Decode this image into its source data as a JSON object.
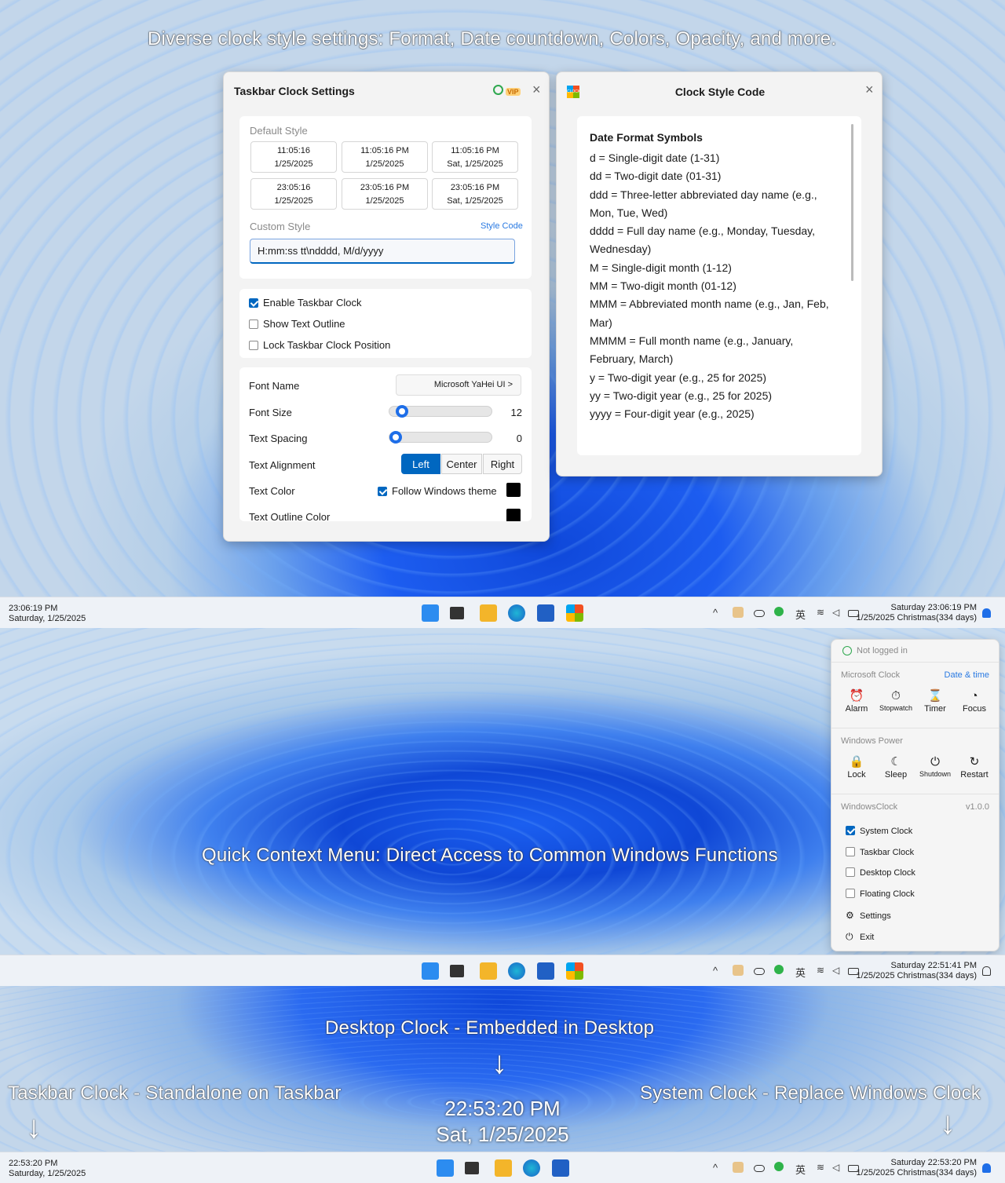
{
  "captions": {
    "top": "Diverse clock style settings: Format, Date countdown, Colors, Opacity, and more.",
    "middle": "Quick Context Menu: Direct Access to Common Windows Functions",
    "desktop": "Desktop Clock - Embedded in Desktop",
    "taskbar": "Taskbar Clock - Standalone on Taskbar",
    "system": "System Clock - Replace Windows Clock"
  },
  "settings": {
    "title": "Taskbar Clock Settings",
    "vip": "VIP",
    "close": "×",
    "default_style_label": "Default Style",
    "presets": [
      {
        "l1": "11:05:16",
        "l2": "1/25/2025"
      },
      {
        "l1": "11:05:16 PM",
        "l2": "1/25/2025"
      },
      {
        "l1": "11:05:16 PM",
        "l2": "Sat, 1/25/2025"
      },
      {
        "l1": "23:05:16",
        "l2": "1/25/2025"
      },
      {
        "l1": "23:05:16 PM",
        "l2": "1/25/2025"
      },
      {
        "l1": "23:05:16 PM",
        "l2": "Sat, 1/25/2025"
      }
    ],
    "custom_style_label": "Custom Style",
    "style_code_link": "Style Code",
    "custom_style_value": "H:mm:ss tt\\ndddd, M/d/yyyy",
    "checks": [
      {
        "label": "Enable Taskbar Clock",
        "checked": true
      },
      {
        "label": "Show Text Outline",
        "checked": false
      },
      {
        "label": "Lock Taskbar Clock Position",
        "checked": false
      }
    ],
    "font_name_label": "Font Name",
    "font_name_value": "Microsoft YaHei UI  >",
    "font_size_label": "Font Size",
    "font_size_value": "12",
    "text_spacing_label": "Text Spacing",
    "text_spacing_value": "0",
    "text_alignment_label": "Text Alignment",
    "align_left": "Left",
    "align_center": "Center",
    "align_right": "Right",
    "text_color_label": "Text Color",
    "follow_theme_label": "Follow Windows theme",
    "text_outline_color_label": "Text Outline Color",
    "text_color": "#000000"
  },
  "stylecode": {
    "logo": "CLOCK",
    "title": "Clock Style Code",
    "close": "×",
    "heading": "Date Format Symbols",
    "lines": [
      "d = Single-digit date (1-31)",
      "dd = Two-digit date (01-31)",
      "ddd = Three-letter abbreviated day name (e.g.,",
      "Mon, Tue, Wed)",
      "dddd = Full day name (e.g., Monday, Tuesday,",
      "Wednesday)",
      "M = Single-digit month (1-12)",
      "MM = Two-digit month (01-12)",
      "MMM = Abbreviated month name (e.g., Jan, Feb,",
      "Mar)",
      "MMMM = Full month name (e.g., January,",
      "February, March)",
      "y = Two-digit year (e.g., 25 for 2025)",
      "yy = Two-digit year (e.g., 25 for 2025)",
      "yyyy = Four-digit year (e.g., 2025)"
    ]
  },
  "taskbar1": {
    "left_l1": "23:06:19 PM",
    "left_l2": "Saturday, 1/25/2025",
    "right_l1": "Saturday 23:06:19 PM",
    "right_l2": "1/25/2025 Christmas(334 days)"
  },
  "taskbar2": {
    "right_l1": "Saturday 22:51:41 PM",
    "right_l2": "1/25/2025 Christmas(334 days)"
  },
  "taskbar3": {
    "left_l1": "22:53:20 PM",
    "left_l2": "Saturday, 1/25/2025",
    "right_l1": "Saturday 22:53:20 PM",
    "right_l2": "1/25/2025 Christmas(334 days)"
  },
  "tray": {
    "up": "^",
    "ime": "英"
  },
  "desktop_clock": {
    "l1": "22:53:20 PM",
    "l2": "Sat, 1/25/2025"
  },
  "menu": {
    "login": "Not logged in",
    "ms_clock": "Microsoft Clock",
    "date_time": "Date & time",
    "alarm": "Alarm",
    "stopwatch": "Stopwatch",
    "timer": "Timer",
    "focus": "Focus",
    "power": "Windows Power",
    "lock": "Lock",
    "sleep": "Sleep",
    "shutdown": "Shutdown",
    "restart": "Restart",
    "app": "WindowsClock",
    "version": "v1.0.0",
    "system_clock": "System Clock",
    "taskbar_clock": "Taskbar Clock",
    "desktop_clock": "Desktop Clock",
    "floating_clock": "Floating Clock",
    "settings": "Settings",
    "exit": "Exit"
  },
  "arrows": {
    "down": "↓"
  },
  "colors": {
    "accent": "#0067c0",
    "link": "#2a7ae2"
  }
}
